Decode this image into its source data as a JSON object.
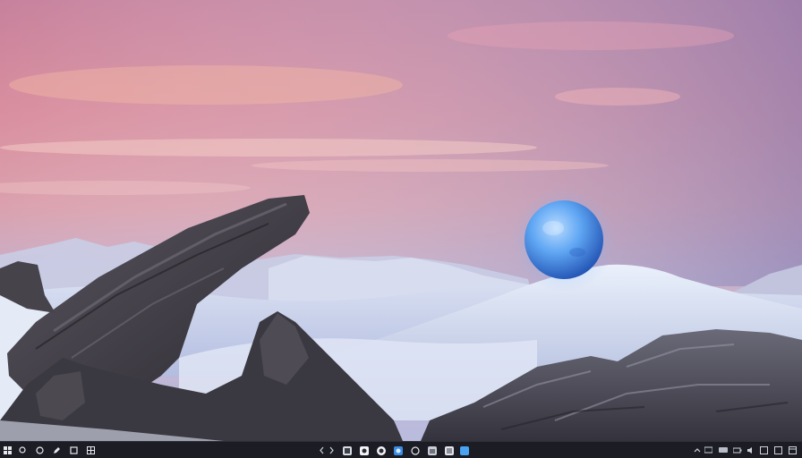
{
  "desktop": {
    "wallpaper": {
      "sky_colors": [
        "#8a7cb2",
        "#c98aa6",
        "#e8a7b0",
        "#b6b3d4"
      ],
      "snow_color": "#dfe6f5",
      "orb_color": "#5aa2ff",
      "rock_color": "#3c3a40"
    }
  },
  "taskbar": {
    "left_icons": [
      "start-icon",
      "search-icon",
      "task-view-icon",
      "pen-icon",
      "file-icon",
      "widgets-icon"
    ],
    "center_icons": [
      "code-icon",
      "app-icon-1",
      "browser-icon",
      "edge-icon",
      "circle-app-icon",
      "settings-icon",
      "store-icon",
      "photos-icon"
    ],
    "tray_icons": [
      "chevron-up-icon",
      "network-icon",
      "battery-icon",
      "volume-icon",
      "notification-icon",
      "show-desktop-icon"
    ],
    "accent": "#3a8ee6"
  }
}
